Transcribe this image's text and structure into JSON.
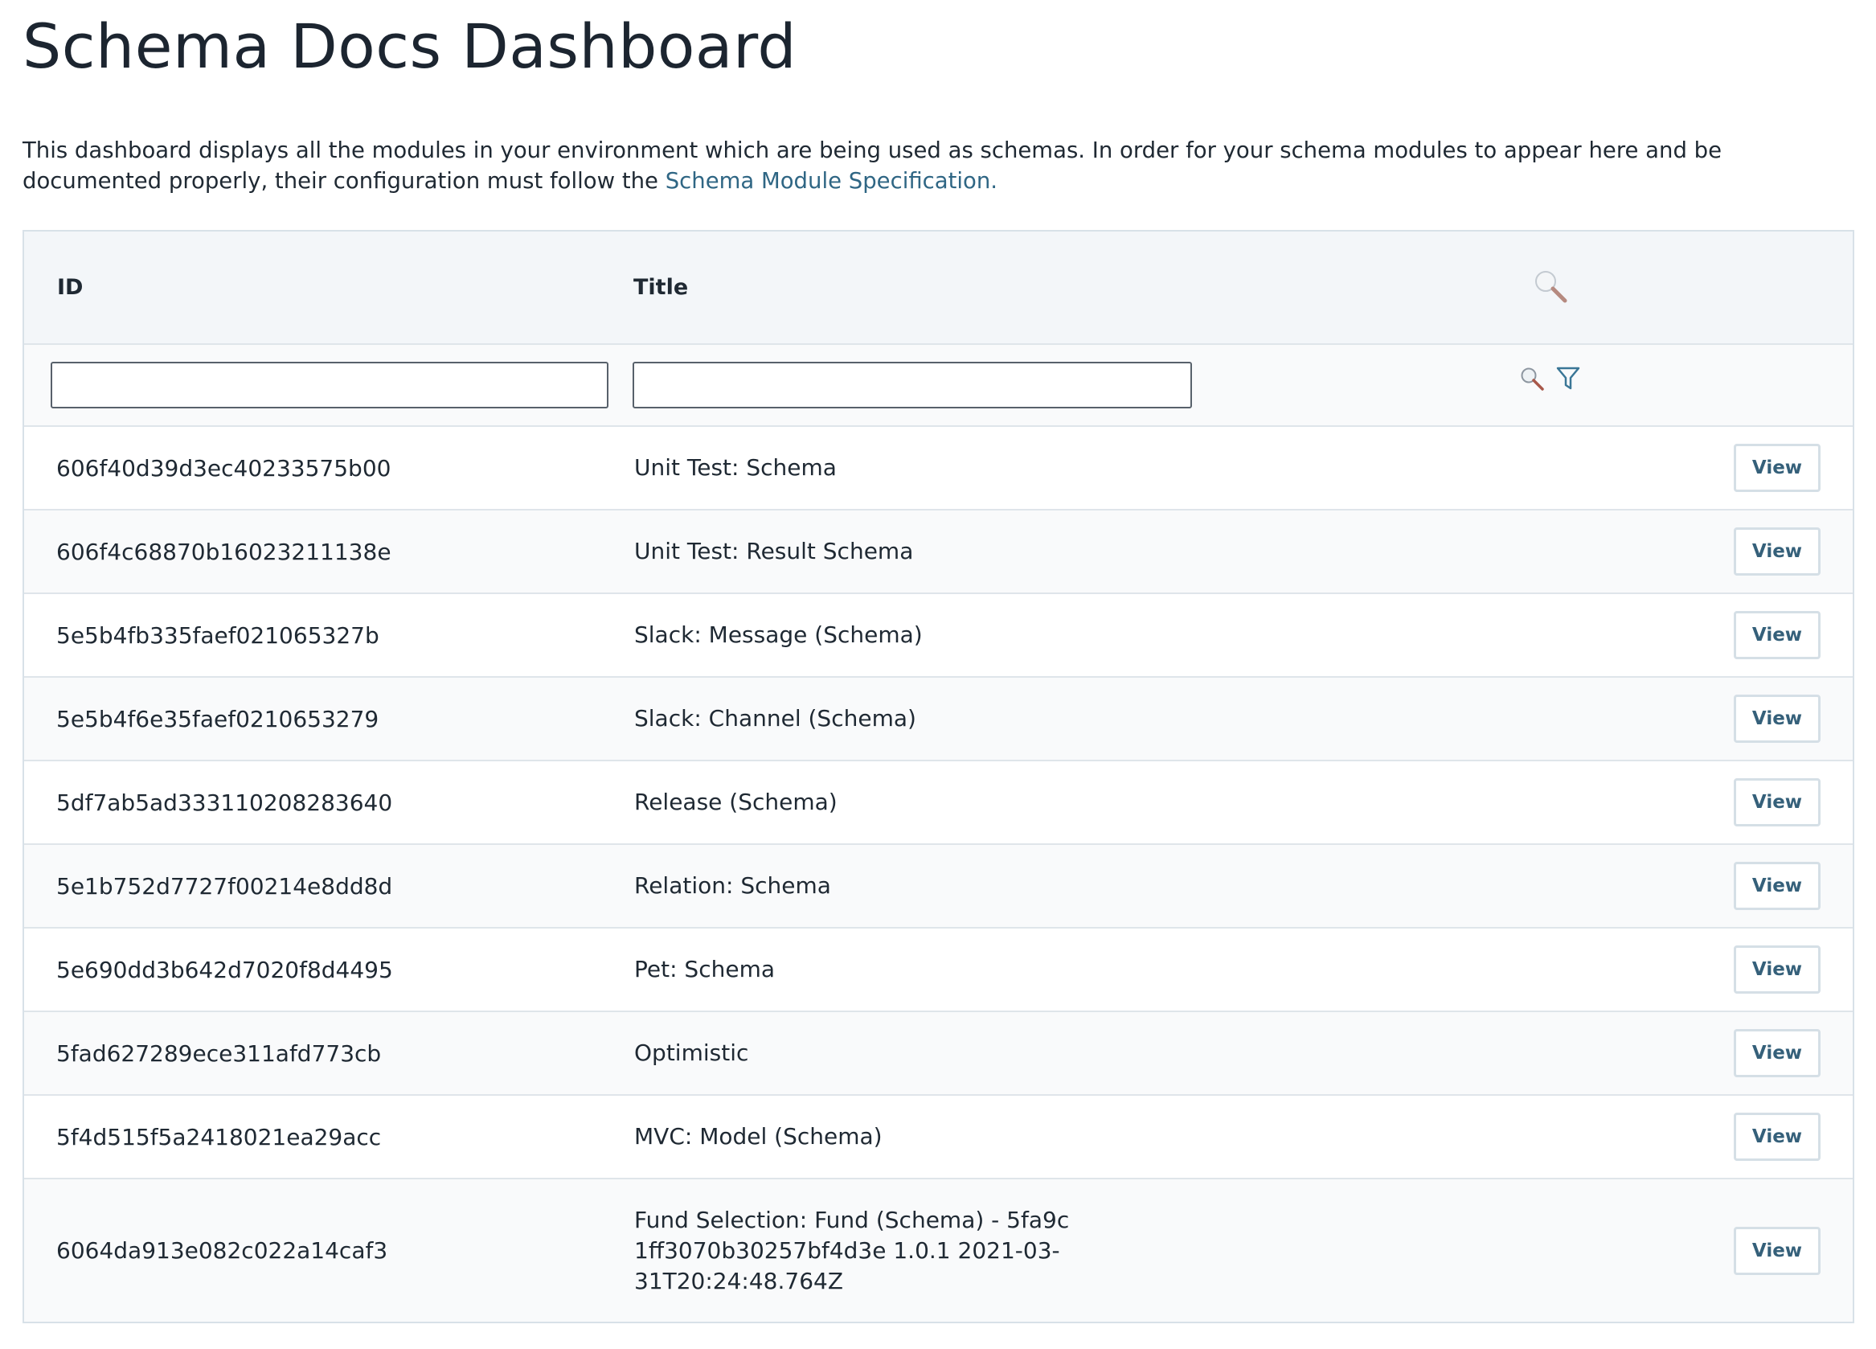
{
  "page": {
    "title": "Schema Docs Dashboard",
    "intro_text": "This dashboard displays all the modules in your environment which are being used as schemas. In order for your schema modules to appear here and be documented properly, their configuration must follow the ",
    "intro_link": "Schema Module Specification."
  },
  "table": {
    "headers": {
      "id": "ID",
      "title": "Title"
    },
    "filters": {
      "id_value": "",
      "title_value": ""
    },
    "icons": {
      "header": "search-icon",
      "filter_search": "search-icon",
      "filter_toggle": "filter-icon"
    },
    "colors": {
      "link": "#2f6684",
      "button_text": "#35607a",
      "border": "#d8e1e8",
      "header_bg": "#f3f6f9"
    },
    "rows": [
      {
        "id": "606f40d39d3ec40233575b00",
        "title": "Unit Test: Schema",
        "action": "View"
      },
      {
        "id": "606f4c68870b16023211138e",
        "title": "Unit Test: Result Schema",
        "action": "View"
      },
      {
        "id": "5e5b4fb335faef021065327b",
        "title": "Slack: Message (Schema)",
        "action": "View"
      },
      {
        "id": "5e5b4f6e35faef0210653279",
        "title": "Slack: Channel (Schema)",
        "action": "View"
      },
      {
        "id": "5df7ab5ad333110208283640",
        "title": "Release (Schema)",
        "action": "View"
      },
      {
        "id": "5e1b752d7727f00214e8dd8d",
        "title": "Relation: Schema",
        "action": "View"
      },
      {
        "id": "5e690dd3b642d7020f8d4495",
        "title": "Pet: Schema",
        "action": "View"
      },
      {
        "id": "5fad627289ece311afd773cb",
        "title": "Optimistic",
        "action": "View"
      },
      {
        "id": "5f4d515f5a2418021ea29acc",
        "title": "MVC: Model (Schema)",
        "action": "View"
      },
      {
        "id": "6064da913e082c022a14caf3",
        "title": "Fund Selection: Fund (Schema) - 5fa9c1ff3070b30257bf4d3e 1.0.1 2021-03-31T20:24:48.764Z",
        "action": "View"
      }
    ]
  }
}
